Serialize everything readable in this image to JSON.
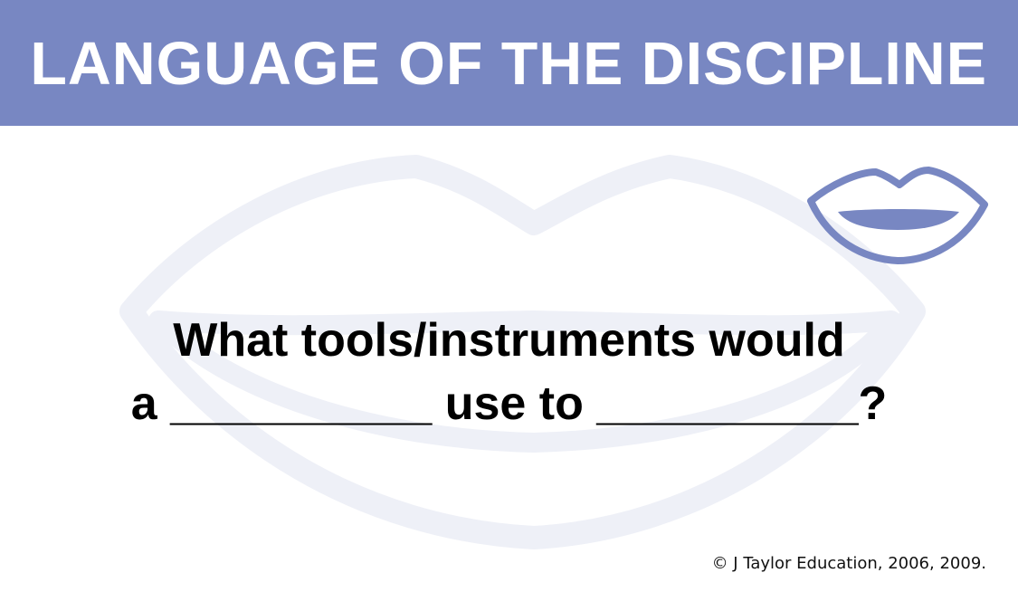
{
  "banner": {
    "title": "LANGUAGE OF THE DISCIPLINE",
    "color": "#7887c2"
  },
  "question": {
    "line1": "What tools/instruments would",
    "line2": "a __________ use to __________?"
  },
  "credit": "© J Taylor Education, 2006, 2009.",
  "icons": {
    "corner": "lips-icon",
    "background": "lips-watermark"
  },
  "colors": {
    "accent": "#7887c2",
    "watermark": "#eef0f7",
    "text": "#000000"
  }
}
